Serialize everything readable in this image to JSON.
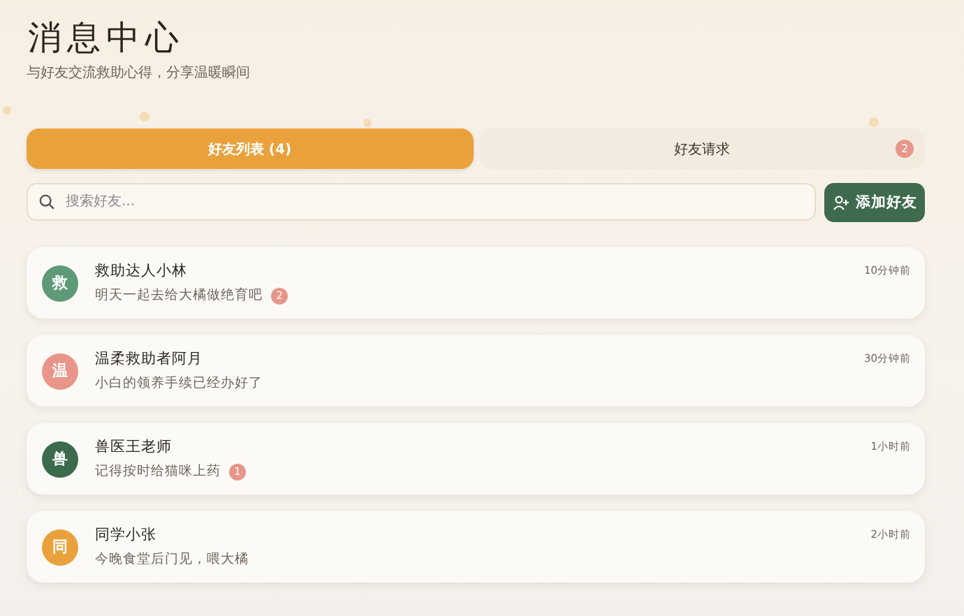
{
  "header": {
    "title": "消息中心",
    "subtitle": "与好友交流救助心得，分享温暖瞬间"
  },
  "tabs": [
    {
      "label": "好友列表 (4)",
      "selected": true
    },
    {
      "label": "好友请求",
      "selected": false,
      "badge": "2"
    }
  ],
  "search": {
    "placeholder": "搜索好友..."
  },
  "add_button": {
    "label": "添加好友"
  },
  "friends": [
    {
      "avatar": "救",
      "color": "#5e9a78",
      "name": "救助达人小林",
      "message": "明天一起去给大橘做绝育吧",
      "unread": "2",
      "time": "10分钟前"
    },
    {
      "avatar": "温",
      "color": "#e8968a",
      "name": "温柔救助者阿月",
      "message": "小白的领养手续已经办好了",
      "time": "30分钟前"
    },
    {
      "avatar": "兽",
      "color": "#3b6b4c",
      "name": "兽医王老师",
      "message": "记得按时给猫咪上药",
      "unread": "1",
      "time": "1小时前"
    },
    {
      "avatar": "同",
      "color": "#e9a23b",
      "name": "同学小张",
      "message": "今晚食堂后门见，喂大橘",
      "time": "2小时前"
    }
  ]
}
